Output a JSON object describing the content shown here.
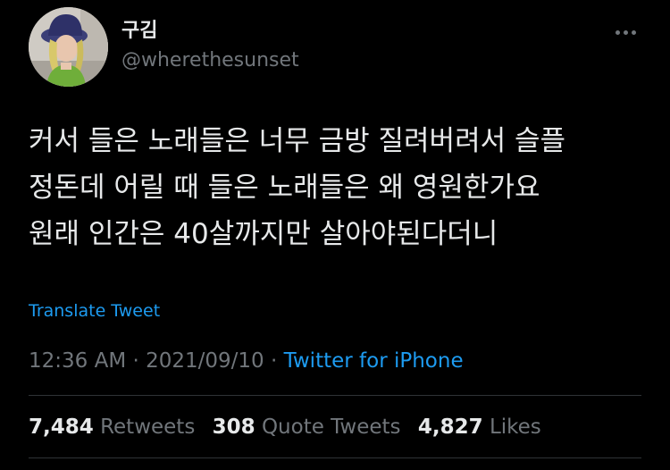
{
  "author": {
    "display_name": "구김",
    "handle": "@wherethesunset",
    "avatar_icon": "profile-photo"
  },
  "menu": {
    "icon": "more-horizontal-icon"
  },
  "tweet": {
    "lines": [
      "커서 들은 노래들은 너무 금방 질려버려서 슬플",
      "정돈데 어릴 때 들은 노래들은 왜 영원한가요",
      "원래 인간은 40살까지만 살아야된다더니"
    ],
    "translate_label": "Translate Tweet",
    "time": "12:36 AM",
    "date": "2021/09/10",
    "separator": "·",
    "source": "Twitter for iPhone"
  },
  "stats": {
    "retweets_count": "7,484",
    "retweets_label": "Retweets",
    "quotes_count": "308",
    "quotes_label": "Quote Tweets",
    "likes_count": "4,827",
    "likes_label": "Likes"
  },
  "colors": {
    "background": "#000000",
    "text": "#e7e9ea",
    "secondary": "#71767b",
    "accent": "#1d9bf0",
    "divider": "#2f3336"
  }
}
